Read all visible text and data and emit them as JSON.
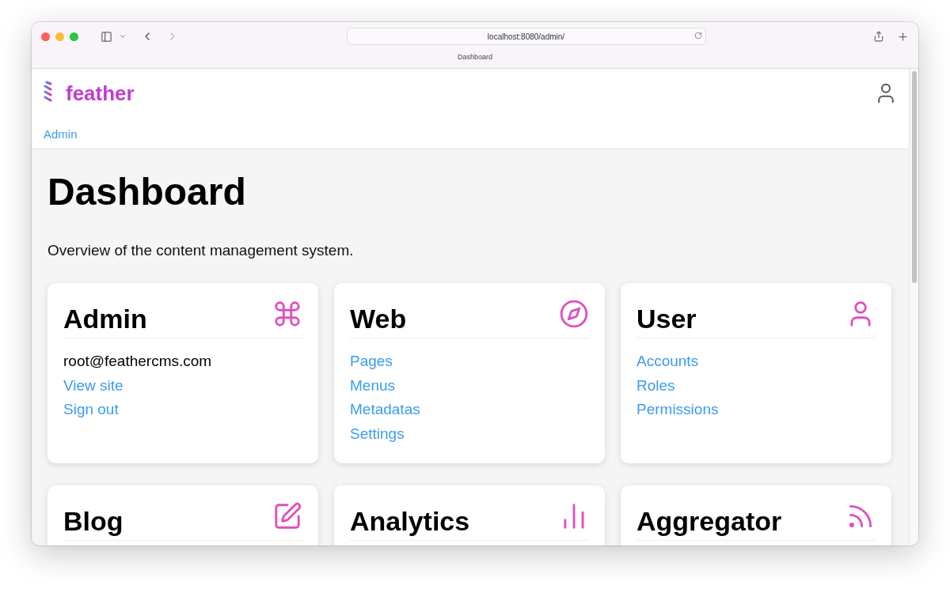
{
  "browser": {
    "url": "localhost:8080/admin/",
    "tab_title": "Dashboard"
  },
  "header": {
    "logo_text": "feather",
    "breadcrumb": "Admin"
  },
  "page": {
    "title": "Dashboard",
    "subtitle": "Overview of the content management system."
  },
  "cards": [
    {
      "title": "Admin",
      "items": [
        {
          "kind": "text",
          "label": "root@feathercms.com"
        },
        {
          "kind": "link",
          "label": "View site"
        },
        {
          "kind": "link",
          "label": "Sign out"
        }
      ]
    },
    {
      "title": "Web",
      "items": [
        {
          "kind": "link",
          "label": "Pages"
        },
        {
          "kind": "link",
          "label": "Menus"
        },
        {
          "kind": "link",
          "label": "Metadatas"
        },
        {
          "kind": "link",
          "label": "Settings"
        }
      ]
    },
    {
      "title": "User",
      "items": [
        {
          "kind": "link",
          "label": "Accounts"
        },
        {
          "kind": "link",
          "label": "Roles"
        },
        {
          "kind": "link",
          "label": "Permissions"
        }
      ]
    },
    {
      "title": "Blog"
    },
    {
      "title": "Analytics"
    },
    {
      "title": "Aggregator"
    }
  ]
}
